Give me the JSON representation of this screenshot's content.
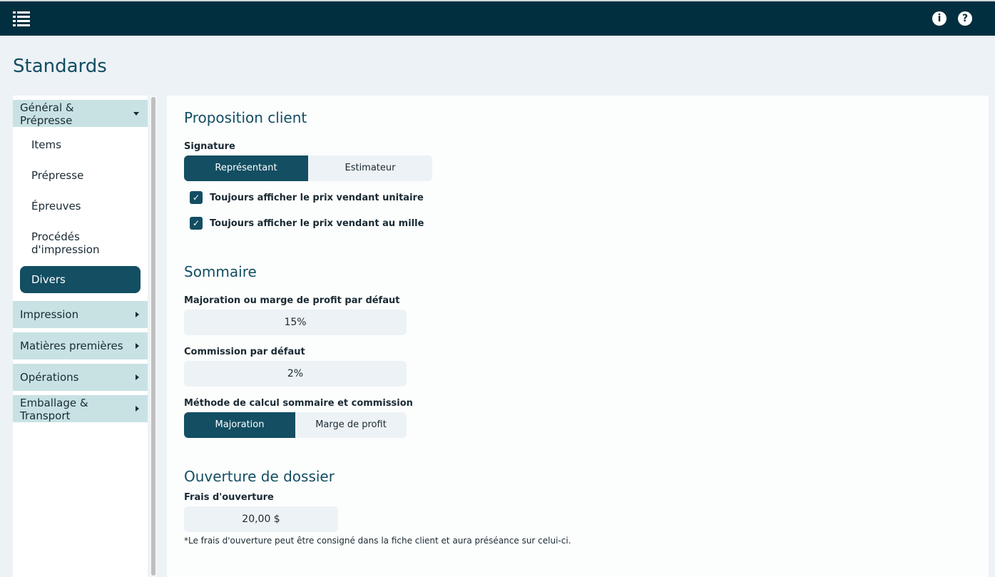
{
  "header": {
    "menu_icon": "hamburger-list-icon",
    "info_icon": "info-icon",
    "info_glyph": "i",
    "help_icon": "help-icon",
    "help_glyph": "?"
  },
  "page_title": "Standards",
  "sidebar": {
    "groups": [
      {
        "label_line1": "Général &",
        "label_line2": "Prépresse",
        "expanded": true
      },
      {
        "label": "Impression",
        "expanded": false
      },
      {
        "label": "Matières premières",
        "expanded": false
      },
      {
        "label": "Opérations",
        "expanded": false
      },
      {
        "label_line1": "Emballage &",
        "label_line2": "Transport",
        "expanded": false
      }
    ],
    "subitems": [
      {
        "label": "Items"
      },
      {
        "label": "Prépresse"
      },
      {
        "label": "Épreuves"
      },
      {
        "label_line1": "Procédés",
        "label_line2": "d'impression"
      },
      {
        "label": "Divers",
        "active": true
      }
    ]
  },
  "proposition": {
    "title": "Proposition client",
    "signature_label": "Signature",
    "signature_options": [
      "Représentant",
      "Estimateur"
    ],
    "signature_selected": "Représentant",
    "checkbox1": "Toujours afficher le prix vendant unitaire",
    "checkbox2": "Toujours afficher le prix vendant au mille",
    "checkbox1_checked": true,
    "checkbox2_checked": true,
    "check_glyph": "✓"
  },
  "sommaire": {
    "title": "Sommaire",
    "markup_label": "Majoration ou marge de profit par défaut",
    "markup_value": "15%",
    "commission_label": "Commission par défaut",
    "commission_value": "2%",
    "method_label": "Méthode de calcul sommaire et commission",
    "method_options": [
      "Majoration",
      "Marge de profit"
    ],
    "method_selected": "Majoration"
  },
  "ouverture": {
    "title": "Ouverture de dossier",
    "fee_label": "Frais d'ouverture",
    "fee_value": "20,00 $",
    "note": "*Le frais d'ouverture peut être consigné dans la fiche client et aura préséance sur celui-ci."
  },
  "colors": {
    "topbar": "#012f3f",
    "accent": "#134e62",
    "group_bg": "#c8e2e4"
  }
}
